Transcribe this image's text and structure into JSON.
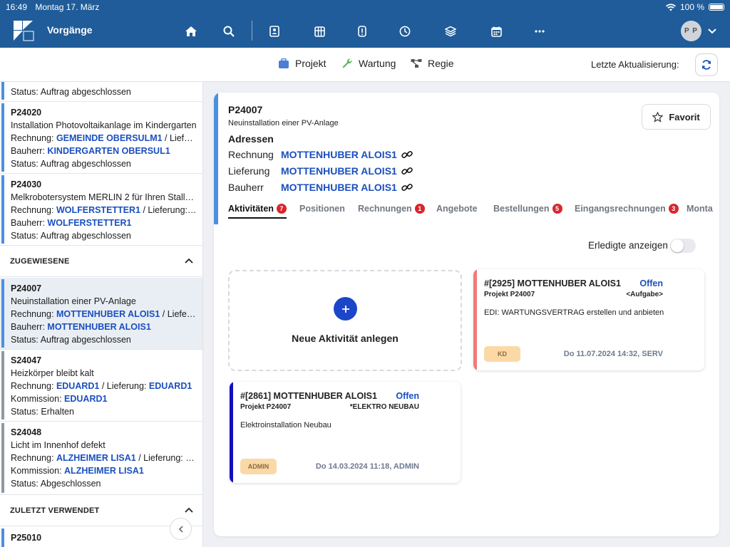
{
  "statusbar": {
    "time": "16:49",
    "date": "Montag 17. März",
    "battery": "100 %"
  },
  "header": {
    "title": "Vorgänge",
    "icons": [
      "home-icon",
      "search-icon",
      "contact-card-icon",
      "grid-icon",
      "document-icon",
      "clock-icon",
      "layers-icon",
      "calendar-icon",
      "more-icon"
    ],
    "avatar_initials": "P P"
  },
  "toolbar": {
    "items": [
      {
        "label": "Projekt",
        "icon": "briefcase-icon",
        "color": "#4a7fd4"
      },
      {
        "label": "Wartung",
        "icon": "wrench-icon",
        "color": "#5cb85c"
      },
      {
        "label": "Regie",
        "icon": "flow-icon",
        "color": "#555555"
      }
    ],
    "last_update_label": "Letzte Aktualisierung:"
  },
  "sidebar": {
    "top_partial": {
      "status": "Status: Auftrag abgeschlossen"
    },
    "cards_a": [
      {
        "num": "P24020",
        "desc": "Installation Photovoltaikanlage im Kindergarten",
        "l1_label": "Rechnung: ",
        "l1_val": "GEMEINDE OBERSULM1",
        "l1_rest": " / Lieferun...",
        "l2_label": "Bauherr: ",
        "l2_val": "KINDERGARTEN OBERSUL1",
        "status": "Status: Auftrag abgeschlossen"
      },
      {
        "num": "P24030",
        "desc": "Melkrobotersystem MERLIN 2 für Ihren Stallne...",
        "l1_label": "Rechnung: ",
        "l1_val": "WOLFERSTETTER1",
        "l1_rest": " / Lieferung: ",
        "l1_val2": "W...",
        "l2_label": "Bauherr: ",
        "l2_val": "WOLFERSTETTER1",
        "status": "Status: Auftrag abgeschlossen"
      }
    ],
    "section_assigned": "ZUGEWIESENE",
    "cards_b": [
      {
        "num": "P24007",
        "desc": "Neuinstallation einer PV-Anlage",
        "l1_label": "Rechnung: ",
        "l1_val": "MOTTENHUBER ALOIS1",
        "l1_rest": " / Lieferun...",
        "l2_label": "Bauherr: ",
        "l2_val": "MOTTENHUBER ALOIS1",
        "status": "Status: Auftrag abgeschlossen"
      },
      {
        "num": "S24047",
        "desc": "Heizkörper bleibt kalt",
        "l1_label": "Rechnung: ",
        "l1_val": "EDUARD1",
        "l1_rest": " / Lieferung: ",
        "l1_val2": "EDUARD1",
        "l2_label": "Kommission: ",
        "l2_val": "EDUARD1",
        "status": "Status: Erhalten"
      },
      {
        "num": "S24048",
        "desc": "Licht im Innenhof defekt",
        "l1_label": "Rechnung: ",
        "l1_val": "ALZHEIMER LISA1",
        "l1_rest": " / Lieferung: ",
        "l1_val2": "AL...",
        "l2_label": "Kommission: ",
        "l2_val": "ALZHEIMER LISA1",
        "status": "Status: Abgeschlossen"
      }
    ],
    "section_recent": "ZULETZT VERWENDET",
    "recent_first": {
      "num": "P25010"
    }
  },
  "detail": {
    "number": "P24007",
    "subtitle": "Neuinstallation einer PV-Anlage",
    "addresses_title": "Adressen",
    "addresses": [
      {
        "label": "Rechnung",
        "value": "MOTTENHUBER ALOIS1"
      },
      {
        "label": "Lieferung",
        "value": "MOTTENHUBER ALOIS1"
      },
      {
        "label": "Bauherr",
        "value": "MOTTENHUBER ALOIS1"
      }
    ],
    "favorite_label": "Favorit",
    "tabs": [
      {
        "label": "Aktivitäten",
        "badge": "7"
      },
      {
        "label": "Positionen",
        "badge": ""
      },
      {
        "label": "Rechnungen",
        "badge": "1"
      },
      {
        "label": "Angebote",
        "badge": ""
      },
      {
        "label": "Bestellungen",
        "badge": "5"
      },
      {
        "label": "Eingangsrechnungen",
        "badge": "3"
      },
      {
        "label": "Monta",
        "badge": ""
      }
    ],
    "show_done_label": "Erledigte anzeigen",
    "new_activity_label": "Neue Aktivität anlegen",
    "activities": [
      {
        "title": "#[2925] MOTTENHUBER ALOIS1",
        "status": "Offen",
        "project": "Projekt P24007",
        "type": "<Aufgabe>",
        "desc": "EDI: WARTUNGSVERTRAG erstellen und anbieten",
        "tag": "KD",
        "date": "Do 11.07.2024 14:32, SERV",
        "color": "#f07a7a"
      },
      {
        "title": "#[2861] MOTTENHUBER ALOIS1",
        "status": "Offen",
        "project": "Projekt P24007",
        "type": "*ELEKTRO NEUBAU",
        "desc": "Elektroinstallation Neubau",
        "tag": "ADMIN",
        "date": "Do 14.03.2024 11:18, ADMIN",
        "color": "#1010c0"
      }
    ]
  },
  "colors": {
    "brand": "#1f5c99",
    "link": "#1a4fbf",
    "badge": "#d9262c",
    "accent_blue": "#4a90e2"
  }
}
